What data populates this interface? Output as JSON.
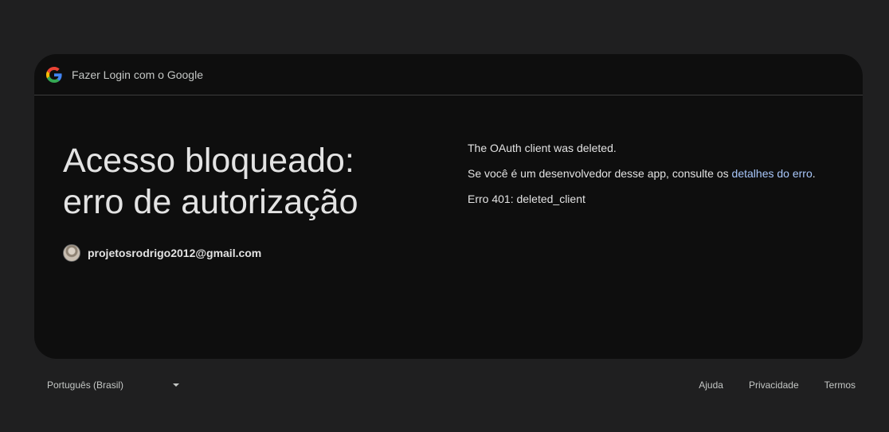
{
  "header": {
    "logo_icon": "google-g-icon",
    "title": "Fazer Login com o Google"
  },
  "main": {
    "heading_line1": "Acesso bloqueado:",
    "heading_line2": "erro de autorização",
    "account_email": "projetosrodrigo2012@gmail.com",
    "avatar_icon": "user-avatar"
  },
  "details": {
    "message": "The OAuth client was deleted.",
    "developer_prefix": "Se você é um desenvolvedor desse app, consulte os ",
    "developer_link": "detalhes do erro",
    "developer_suffix": ".",
    "error_code": "Erro 401: deleted_client"
  },
  "footer": {
    "language": "Português (Brasil)",
    "language_icon": "chevron-down-icon",
    "links": [
      "Ajuda",
      "Privacidade",
      "Termos"
    ]
  },
  "colors": {
    "page_background": "#1f1f20",
    "card_background": "#0e0e0e",
    "link": "#a8c7fa",
    "text": "#e3e3e3"
  }
}
